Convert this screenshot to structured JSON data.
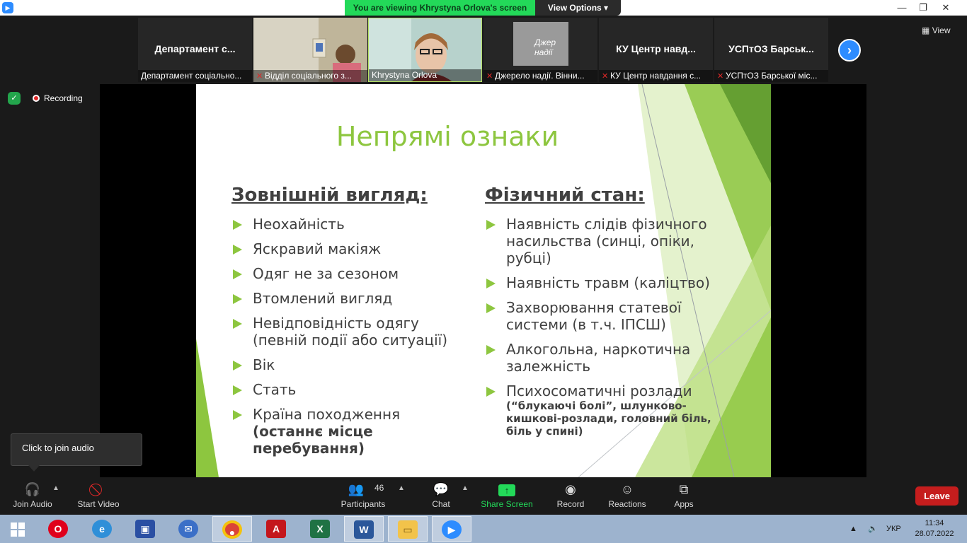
{
  "window": {
    "banner": "You are viewing Khrystyna Orlova's screen",
    "view_options": "View Options",
    "controls": {
      "minimize": "—",
      "restore": "❐",
      "close": "✕"
    }
  },
  "strip": {
    "view_label": "View",
    "tiles": [
      {
        "name": "Департамент  с...",
        "label": "Департамент соціально...",
        "muted": false
      },
      {
        "name": "",
        "label": "Відділ соціального з...",
        "muted": true
      },
      {
        "name": "",
        "label": "Khrystyna Orlova",
        "muted": false
      },
      {
        "name": "",
        "label": "Джерело надії. Вінни...",
        "muted": true,
        "logo": "Джер надії"
      },
      {
        "name": "КУ Центр навд...",
        "label": "КУ Центр навдання с...",
        "muted": true
      },
      {
        "name": "УСПтОЗ  Барськ...",
        "label": "УСПтОЗ Барської міс...",
        "muted": true
      }
    ]
  },
  "recording": {
    "label": "Recording"
  },
  "slide": {
    "title": "Непрямі ознаки",
    "left_heading": "Зовнішній вигляд:",
    "left_items": [
      "Неохайність",
      "Яскравий макіяж",
      "Одяг не за сезоном",
      "Втомлений вигляд",
      "Невідповідність одягу (певній події або ситуації)",
      "Вік",
      "Стать"
    ],
    "left_last_item": {
      "text": "Країна походження ",
      "bold": "(останнє місце перебування)"
    },
    "right_heading": "Фізичний стан:",
    "right_items": [
      "Наявність слідів фізичного насильства (синці, опіки, рубці)",
      "Наявність травм (каліцтво)",
      "Захворювання статевої системи (в т.ч. ІПСШ)",
      "Алкогольна,  наркотична залежність"
    ],
    "right_last_item": {
      "text": "Психосоматичні розлади",
      "sub": "(“блукаючі болі”, шлунково-кишкові-розлади, головний біль, біль у спині)"
    }
  },
  "audio_tooltip": "Click to join audio",
  "toolbar": {
    "join_audio": "Join Audio",
    "start_video": "Start Video",
    "participants": "Participants",
    "participants_count": "46",
    "chat": "Chat",
    "share_screen": "Share Screen",
    "record": "Record",
    "reactions": "Reactions",
    "apps": "Apps",
    "leave": "Leave"
  },
  "taskbar": {
    "language": "УКР",
    "time": "11:34",
    "date": "28.07.2022"
  },
  "colors": {
    "accent_green": "#8dc63f",
    "zoom_blue": "#2d8cff",
    "banner_green": "#23d959",
    "leave_red": "#c51d1d"
  }
}
